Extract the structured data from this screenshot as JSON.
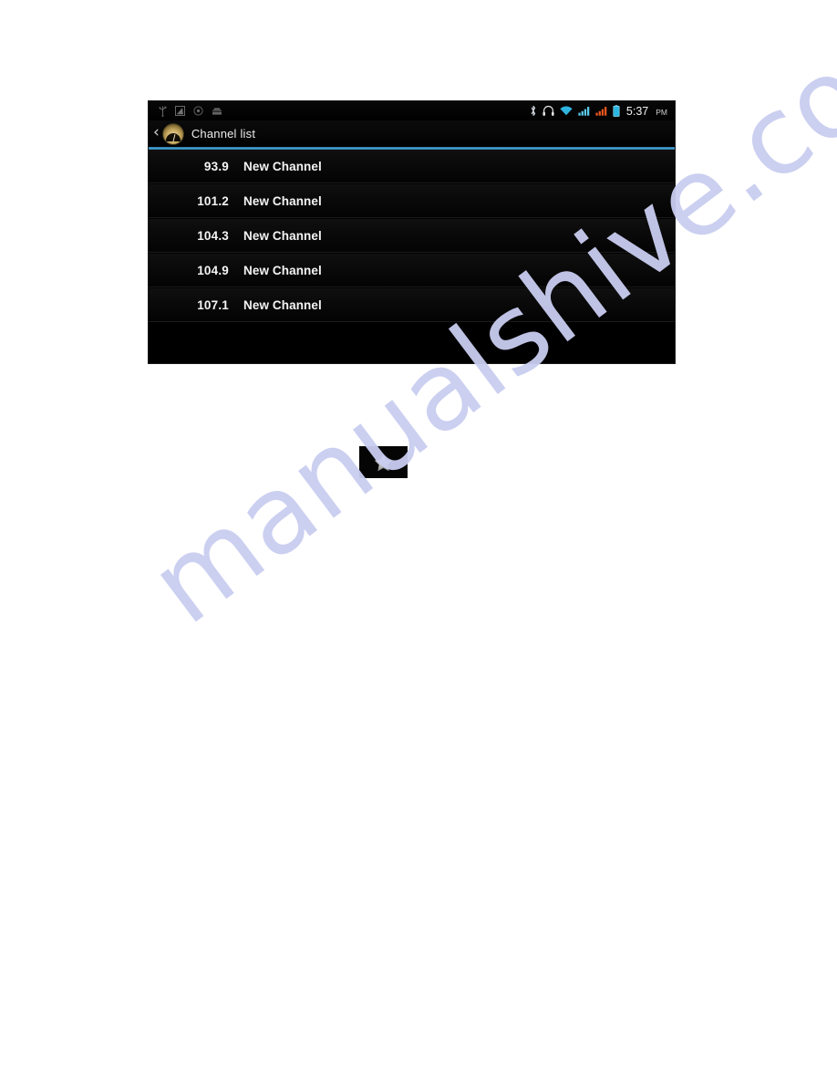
{
  "document": {
    "background_color": "#ffffff",
    "watermark_text": "manualshive.com",
    "watermark_color": "#c9cdf0"
  },
  "device_screenshot": {
    "background_color": "#000000",
    "status_bar": {
      "left_icons": [
        {
          "name": "usb-icon",
          "label": "USB"
        },
        {
          "name": "screenshot-icon",
          "label": "Screenshot"
        },
        {
          "name": "settings-icon",
          "label": "Settings"
        },
        {
          "name": "download-icon",
          "label": "Download"
        }
      ],
      "right_icons": [
        {
          "name": "bluetooth-icon",
          "label": "Bluetooth"
        },
        {
          "name": "headphones-icon",
          "label": "Headphones"
        },
        {
          "name": "wifi-icon",
          "label": "Wi-Fi"
        },
        {
          "name": "signal-sim1-icon",
          "label": "Signal SIM 1"
        },
        {
          "name": "signal-sim2-icon",
          "label": "Signal SIM 2"
        },
        {
          "name": "battery-icon",
          "label": "Battery"
        }
      ],
      "time": "5:37",
      "am_pm": "PM",
      "accent_colors": {
        "wifi": "#29b6e0",
        "signal_primary": "#4fc3e8",
        "signal_secondary": "#e8561e",
        "battery": "#29b6e0"
      }
    },
    "title_bar": {
      "back_label": "‹",
      "app_icon_name": "fm-radio-dial-icon",
      "title": "Channel list",
      "divider_color": "#44a3d4"
    },
    "channel_list": {
      "rows": [
        {
          "frequency": "93.9",
          "name": "New Channel"
        },
        {
          "frequency": "101.2",
          "name": "New Channel"
        },
        {
          "frequency": "104.3",
          "name": "New Channel"
        },
        {
          "frequency": "104.9",
          "name": "New Channel"
        },
        {
          "frequency": "107.1",
          "name": "New Channel"
        }
      ]
    }
  },
  "favorite_button": {
    "icon_name": "star-icon",
    "background_color": "#050505",
    "star_color": "#dcdcdc"
  }
}
